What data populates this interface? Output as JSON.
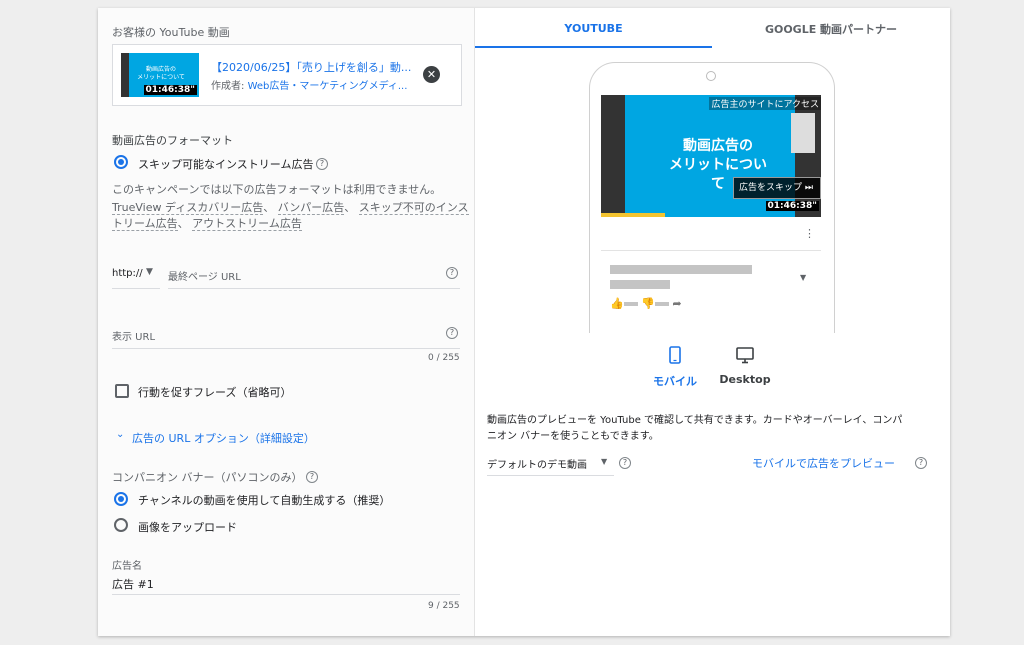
{
  "left": {
    "video_section_label": "お客様の YouTube 動画",
    "video": {
      "thumb_text_line1": "動画広告の",
      "thumb_text_line2": "メリットについて",
      "duration": "01:46:38\"",
      "title": "【2020/06/25】「売り上げを創る」動...",
      "author_prefix": "作成者: ",
      "author": "Web広告・マーケティングメディ..."
    },
    "format_label": "動画広告のフォーマット",
    "format_option": "スキップ可能なインストリーム広告",
    "format_note": "このキャンペーンでは以下の広告フォーマットは利用できません。",
    "format_links_line1": [
      "TrueView ディスカバリー広告",
      "バンパー広告",
      "スキップ不可のインス"
    ],
    "format_links_line2": [
      "トリーム広告",
      "アウトストリーム広告"
    ],
    "url_prefix": "http://",
    "final_url_placeholder": "最終ページ URL",
    "display_url_placeholder": "表示 URL",
    "display_url_count": "0 / 255",
    "cta_label": "行動を促すフレーズ（省略可）",
    "url_options_label": "広告の URL オプション（詳細設定）",
    "companion_label": "コンパニオン バナー（パソコンのみ）",
    "companion_auto": "チャンネルの動画を使用して自動生成する（推奨）",
    "companion_upload": "画像をアップロード",
    "ad_name_label": "広告名",
    "ad_name_value": "広告 #1",
    "ad_name_count": "9 / 255"
  },
  "right": {
    "tabs": [
      "YOUTUBE",
      "GOOGLE 動画パートナー"
    ],
    "preview": {
      "visit_site": "広告主のサイトにアクセス",
      "thumb_line1": "動画広告の",
      "thumb_line2": "メリットについて",
      "skip_label": "広告をスキップ",
      "duration": "01:46:38\"",
      "more": "⋮"
    },
    "device_mobile": "モバイル",
    "device_desktop": "Desktop",
    "description_line1": "動画広告のプレビューを YouTube で確認して共有できます。カードやオーバーレイ、コンパ",
    "description_line2": "ニオン バナーを使うこともできます。",
    "demo_select": "デフォルトのデモ動画",
    "preview_mobile_link": "モバイルで広告をプレビュー"
  },
  "colors": {
    "accent": "#1a73e8",
    "thumb_cyan": "#00a6e2",
    "progress": "#f4c430"
  },
  "icons": {
    "close": "close-circle-icon",
    "help": "help-circle-icon",
    "mobile": "smartphone-icon",
    "desktop": "monitor-icon"
  }
}
